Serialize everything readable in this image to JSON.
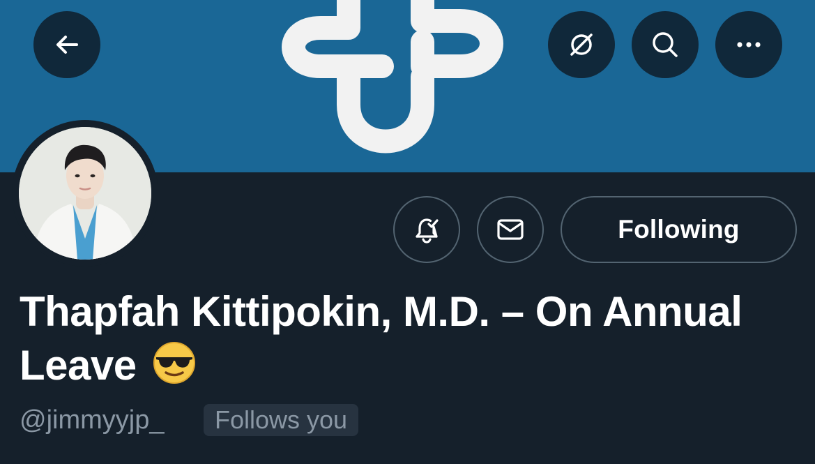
{
  "header": {
    "back_icon": "arrow-left-icon",
    "translate_icon": "translate-off-icon",
    "search_icon": "search-icon",
    "more_icon": "more-horizontal-icon"
  },
  "banner": {
    "color": "#1a6796",
    "logo": "white interlocking cross logo"
  },
  "profile": {
    "display_name": "Thapfah Kittipokin, M.D. – On Annual Leave",
    "name_emoji": "😎",
    "handle": "@jimmyyjp_",
    "follows_you_badge": "Follows you"
  },
  "actions": {
    "notify_icon": "bell-check-icon",
    "message_icon": "envelope-icon",
    "follow_label": "Following"
  },
  "colors": {
    "background": "#15202b",
    "circle_button": "#10283a",
    "border": "#536471",
    "secondary_text": "#8b98a5",
    "badge_bg": "#273340"
  }
}
